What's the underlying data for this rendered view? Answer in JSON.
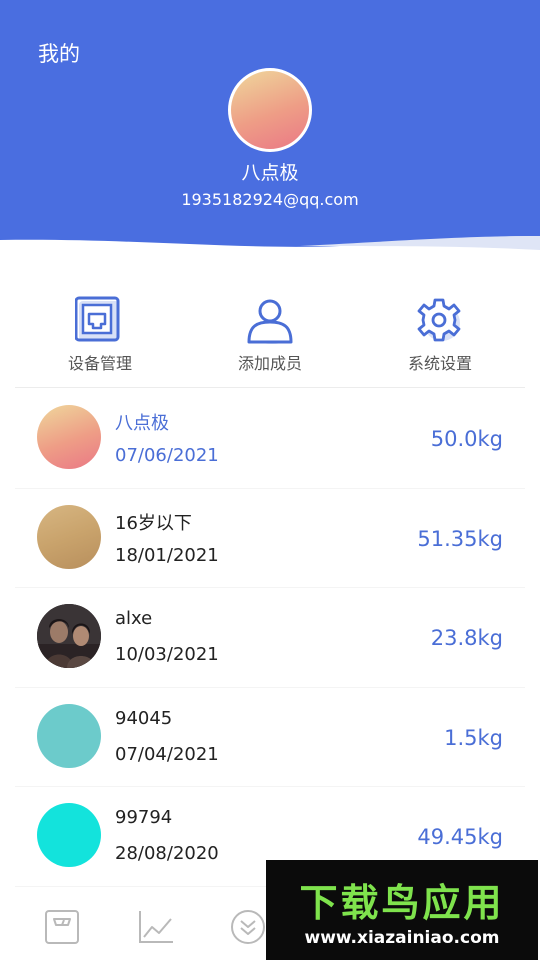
{
  "header": {
    "title": "我的",
    "user_name": "八点极",
    "email": "1935182924@qq.com"
  },
  "actions": [
    {
      "label": "设备管理",
      "icon": "device-icon"
    },
    {
      "label": "添加成员",
      "icon": "person-icon"
    },
    {
      "label": "系统设置",
      "icon": "gear-icon"
    }
  ],
  "members": [
    {
      "name": "八点极",
      "date": "07/06/2021",
      "weight": "50.0kg",
      "avatar": "gradient-avatar",
      "active": true
    },
    {
      "name": "16岁以下",
      "date": "18/01/2021",
      "weight": "51.35kg",
      "avatar": "tan-avatar"
    },
    {
      "name": "alxe",
      "date": "10/03/2021",
      "weight": "23.8kg",
      "avatar": "photo-avatar"
    },
    {
      "name": "94045",
      "date": "07/04/2021",
      "weight": "1.5kg",
      "avatar": "teal-avatar"
    },
    {
      "name": "99794",
      "date": "28/08/2020",
      "weight": "49.45kg",
      "avatar": "cyan-avatar"
    }
  ],
  "bottom_nav": [
    {
      "icon": "scale-icon"
    },
    {
      "icon": "trend-chart-icon"
    },
    {
      "icon": "double-chevron-down-icon"
    }
  ],
  "watermark": {
    "logo": "下载鸟应用",
    "url": "www.xiazainiao.com"
  },
  "colors": {
    "header_blue": "#4a6ee0",
    "accent_blue": "#4a6ed6",
    "watermark_green": "#7fe34d"
  }
}
